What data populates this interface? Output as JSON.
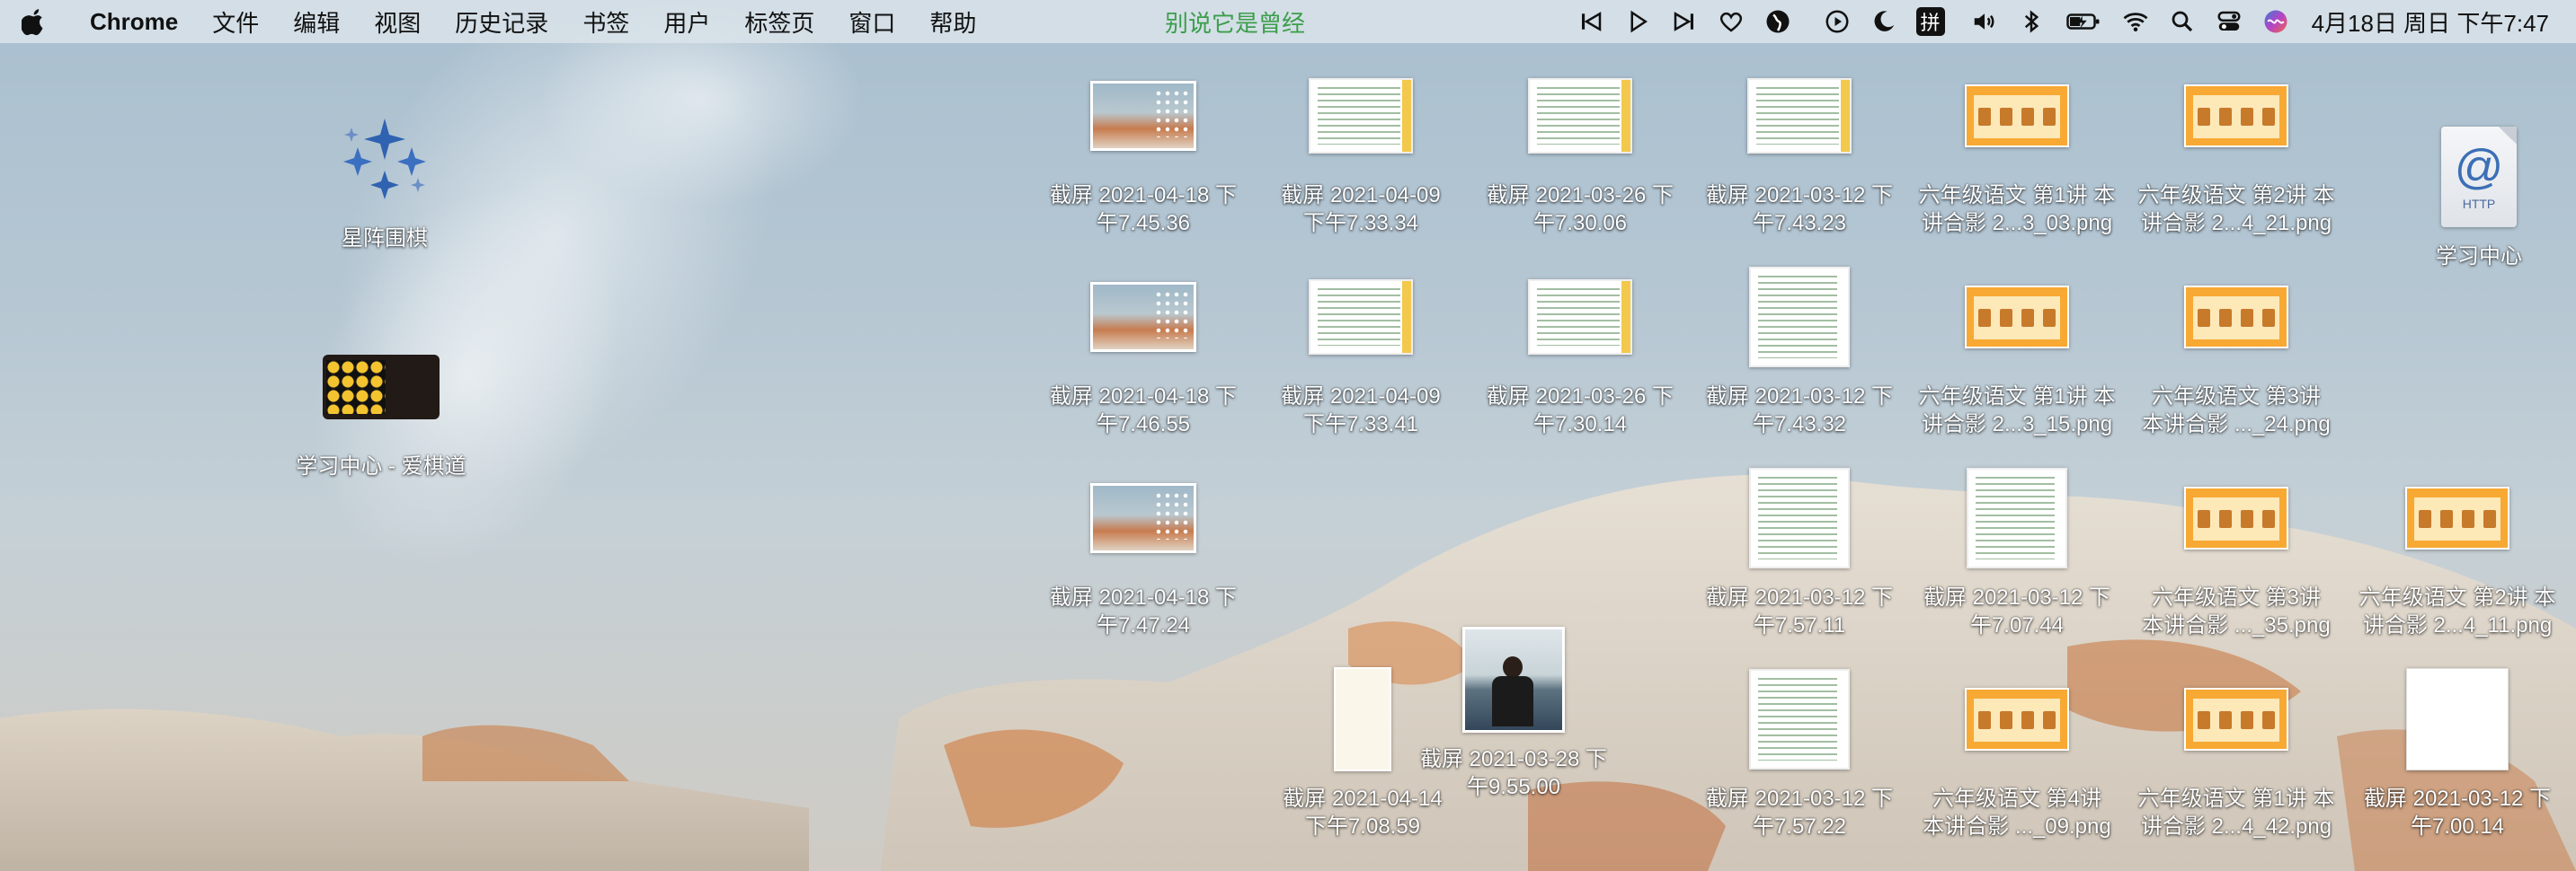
{
  "menubar": {
    "app_name": "Chrome",
    "menus": [
      "文件",
      "编辑",
      "视图",
      "历史记录",
      "书签",
      "用户",
      "标签页",
      "窗口",
      "帮助"
    ],
    "now_playing": "别说它是曾经",
    "input_method": "拼",
    "clock": "4月18日 周日 下午7:47"
  },
  "colors": {
    "now_playing": "#3b9e4a",
    "label_text": "#ffffff"
  },
  "desktop_apps": [
    {
      "name": "星阵围棋",
      "icon": "xingzhen-app-icon"
    },
    {
      "name": "学习中心 - 爱棋道",
      "icon": "aiqidao-app-icon"
    },
    {
      "name": "学习中心",
      "icon": "http-location-icon"
    }
  ],
  "files": [
    {
      "l1": "截屏 2021-04-18 下",
      "l2": "午7.45.36",
      "thumb": "photo"
    },
    {
      "l1": "截屏 2021-04-09",
      "l2": "下午7.33.34",
      "thumb": "code-wide"
    },
    {
      "l1": "截屏 2021-03-26 下",
      "l2": "午7.30.06",
      "thumb": "code-wide"
    },
    {
      "l1": "截屏 2021-03-12 下",
      "l2": "午7.43.23",
      "thumb": "code-wide"
    },
    {
      "l1": "六年级语文 第1讲 本",
      "l2": "讲合影 2...3_03.png",
      "thumb": "orange"
    },
    {
      "l1": "六年级语文 第2讲 本",
      "l2": "讲合影 2...4_21.png",
      "thumb": "orange"
    },
    {
      "l1": "截屏 2021-04-18 下",
      "l2": "午7.46.55",
      "thumb": "photo"
    },
    {
      "l1": "截屏 2021-04-09",
      "l2": "下午7.33.41",
      "thumb": "code-wide"
    },
    {
      "l1": "截屏 2021-03-26 下",
      "l2": "午7.30.14",
      "thumb": "code-wide"
    },
    {
      "l1": "截屏 2021-03-12 下",
      "l2": "午7.43.32",
      "thumb": "code-tall"
    },
    {
      "l1": "六年级语文 第1讲 本",
      "l2": "讲合影 2...3_15.png",
      "thumb": "orange"
    },
    {
      "l1": "六年级语文 第3讲",
      "l2": "本讲合影 ..._24.png",
      "thumb": "orange"
    },
    {
      "l1": "截屏 2021-04-18 下",
      "l2": "午7.47.24",
      "thumb": "photo"
    },
    {
      "l1": "截屏 2021-03-12 下",
      "l2": "午7.57.11",
      "thumb": "code-tall"
    },
    {
      "l1": "截屏 2021-03-12 下",
      "l2": "午7.07.44",
      "thumb": "code-tall"
    },
    {
      "l1": "六年级语文 第3讲",
      "l2": "本讲合影 ..._35.png",
      "thumb": "orange"
    },
    {
      "l1": "六年级语文 第2讲 本",
      "l2": "讲合影 2...4_11.png",
      "thumb": "orange"
    },
    {
      "l1": "截屏 2021-04-14",
      "l2": "下午7.08.59",
      "thumb": "cream"
    },
    {
      "l1": "截屏 2021-03-28 下",
      "l2": "午9.55.00",
      "thumb": "person"
    },
    {
      "l1": "截屏 2021-03-12 下",
      "l2": "午7.57.22",
      "thumb": "code-tall"
    },
    {
      "l1": "六年级语文 第4讲",
      "l2": "本讲合影 ..._09.png",
      "thumb": "orange"
    },
    {
      "l1": "六年级语文 第1讲 本",
      "l2": "讲合影 2...4_42.png",
      "thumb": "orange"
    },
    {
      "l1": "截屏 2021-03-12 下",
      "l2": "午7.00.14",
      "thumb": "blank"
    }
  ]
}
